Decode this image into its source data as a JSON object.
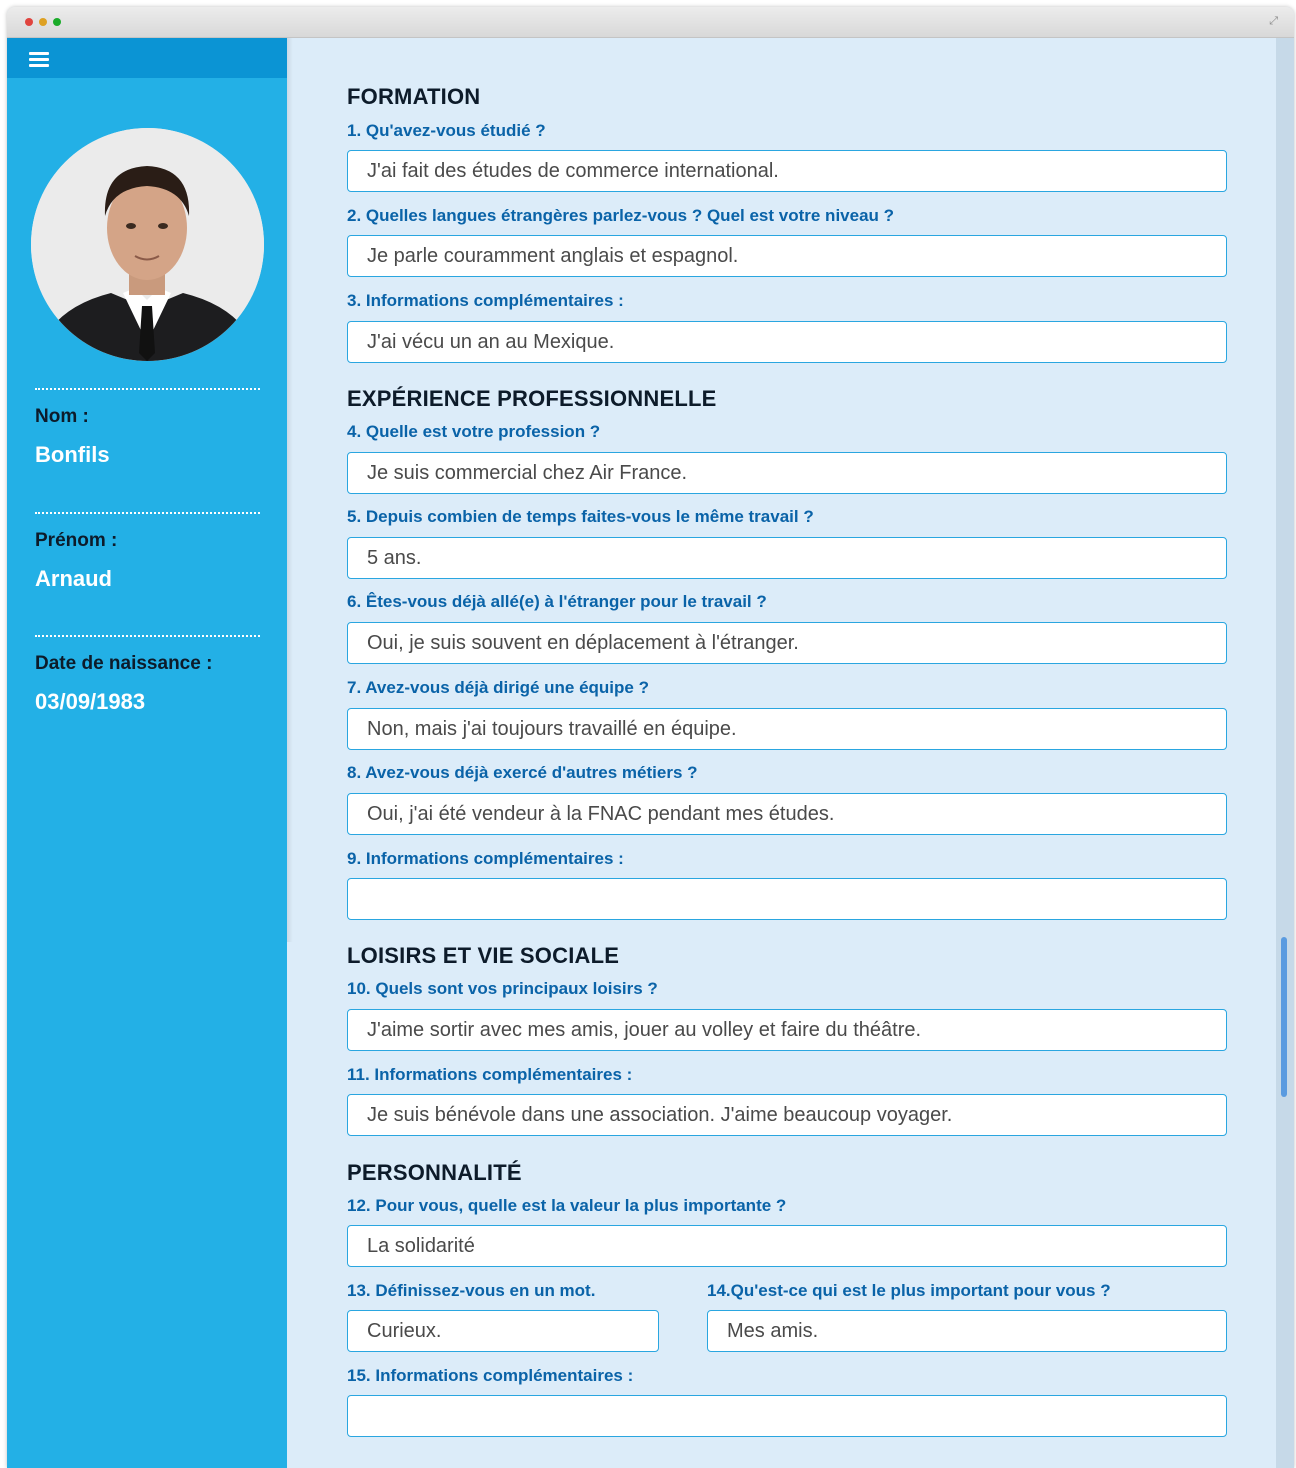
{
  "sidebar": {
    "menu_icon": "hamburger-menu-icon",
    "avatar_alt": "profile-photo",
    "fields": [
      {
        "label": "Nom :",
        "value": "Bonfils"
      },
      {
        "label": "Prénom :",
        "value": "Arnaud"
      },
      {
        "label": "Date de naissance :",
        "value": "03/09/1983"
      }
    ]
  },
  "sections": {
    "formation": "FORMATION",
    "experience": "EXPÉRIENCE PROFESSIONNELLE",
    "loisirs": "LOISIRS ET VIE SOCIALE",
    "personnalite": "PERSONNALITÉ"
  },
  "questions": [
    {
      "label": "1. Qu'avez-vous étudié ?",
      "answer": "J'ai fait des études de commerce international."
    },
    {
      "label": "2. Quelles langues étrangères parlez-vous ? Quel est votre niveau ?",
      "answer": "Je parle couramment anglais et espagnol."
    },
    {
      "label": "3. Informations complémentaires :",
      "answer": "J'ai vécu un an au Mexique."
    },
    {
      "label": "4. Quelle est votre profession ?",
      "answer": "Je suis commercial chez Air France."
    },
    {
      "label": "5. Depuis combien de temps faites-vous le même travail ?",
      "answer": "5 ans."
    },
    {
      "label": "6. Êtes-vous déjà allé(e) à l'étranger pour le travail ?",
      "answer": "Oui, je suis souvent en déplacement à l'étranger."
    },
    {
      "label": "7. Avez-vous déjà dirigé une équipe ?",
      "answer": "Non, mais j'ai toujours travaillé en équipe."
    },
    {
      "label": "8. Avez-vous déjà exercé d'autres métiers ?",
      "answer": "Oui, j'ai été vendeur à la FNAC pendant mes études."
    },
    {
      "label": "9. Informations complémentaires :",
      "answer": ""
    },
    {
      "label": "10. Quels sont vos principaux loisirs ?",
      "answer": "J'aime sortir avec mes amis, jouer au volley et faire du théâtre."
    },
    {
      "label": "11. Informations complémentaires :",
      "answer": "Je suis bénévole dans une association. J'aime beaucoup voyager."
    },
    {
      "label": "12. Pour vous, quelle est la valeur la plus importante ?",
      "answer": "La solidarité"
    },
    {
      "label": "13. Définissez-vous en un mot.",
      "answer": "Curieux."
    },
    {
      "label": "14.Qu'est-ce qui est le plus important pour vous ?",
      "answer": "Mes amis."
    },
    {
      "label": "15. Informations complémentaires :",
      "answer": ""
    }
  ],
  "colors": {
    "sidebar": "#23b0e6",
    "sidebar_top": "#0b94d4",
    "main_bg": "#dcecf9",
    "question_label": "#0a63a8",
    "input_border": "#2aa6e0"
  }
}
